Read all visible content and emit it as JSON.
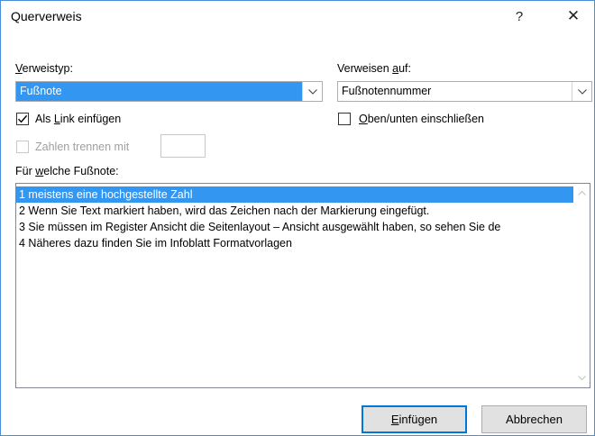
{
  "window": {
    "title": "Querverweis",
    "help_label": "?",
    "close_label": "✕"
  },
  "reference_type": {
    "label_hotkey": "V",
    "label_rest": "erweistyp:",
    "value": "Fußnote"
  },
  "refer_to": {
    "label_before": "Verweisen ",
    "label_hotkey": "a",
    "label_after": "uf:",
    "value": "Fußnotennummer"
  },
  "insert_as_link": {
    "checked": true,
    "label_before": "Als ",
    "label_hotkey": "L",
    "label_after": "ink einfügen"
  },
  "include_above_below": {
    "checked": false,
    "label_hotkey": "O",
    "label_after": "ben/unten einschließen"
  },
  "separate_numbers": {
    "checked": false,
    "enabled": false,
    "label": "Zahlen trennen mit",
    "value": ""
  },
  "for_which": {
    "label_before": "Für ",
    "label_hotkey": "w",
    "label_after": "elche Fußnote:"
  },
  "footnotes": [
    "1  meistens eine hochgestellte Zahl",
    "2  Wenn Sie Text markiert haben, wird das Zeichen nach der Markierung eingefügt.",
    "3  Sie müssen im Register Ansicht die Seitenlayout – Ansicht ausgewählt haben, so sehen Sie de",
    "4  Näheres dazu finden Sie im Infoblatt Formatvorlagen"
  ],
  "selected_footnote_index": 0,
  "buttons": {
    "insert_hotkey": "E",
    "insert_rest": "infügen",
    "cancel_label": "Abbrechen"
  }
}
